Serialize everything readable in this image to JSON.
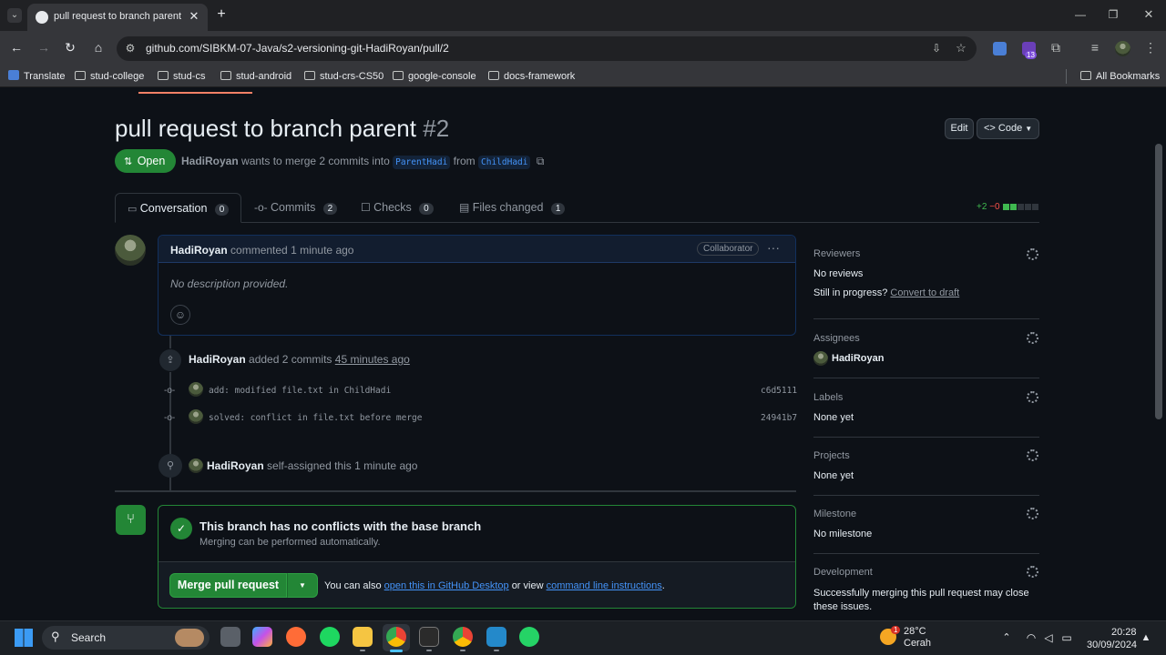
{
  "browser": {
    "tab_title": "pull request to branch parent b",
    "url": "github.com/SIBKM-07-Java/s2-versioning-git-HadiRoyan/pull/2",
    "bookmarks": [
      "Translate",
      "stud-college",
      "stud-cs",
      "stud-android",
      "stud-crs-CS50",
      "google-console",
      "docs-framework"
    ],
    "all_bookmarks": "All Bookmarks",
    "ext_badge": "13"
  },
  "pr": {
    "title": "pull request to branch parent",
    "number": "#2",
    "state": "Open",
    "author": "HadiRoyan",
    "merge_text": "wants to merge 2 commits into",
    "base_branch": "ParentHadi",
    "from_text": "from",
    "head_branch": "ChildHadi",
    "edit_label": "Edit",
    "code_label": "Code"
  },
  "tabs": [
    {
      "label": "Conversation",
      "count": "0"
    },
    {
      "label": "Commits",
      "count": "2"
    },
    {
      "label": "Checks",
      "count": "0"
    },
    {
      "label": "Files changed",
      "count": "1"
    }
  ],
  "diffstat": {
    "additions": "+2",
    "deletions": "−0"
  },
  "comment": {
    "author": "HadiRoyan",
    "action": "commented",
    "time": "1 minute ago",
    "badge": "Collaborator",
    "body": "No description provided."
  },
  "timeline": {
    "commits_author": "HadiRoyan",
    "commits_action": "added 2 commits",
    "commits_time": "45 minutes ago",
    "commits": [
      {
        "message": "add: modified file.txt in ChildHadi",
        "sha": "c6d5111"
      },
      {
        "message": "solved: conflict in file.txt before merge",
        "sha": "24941b7"
      }
    ],
    "assign_author": "HadiRoyan",
    "assign_text": "self-assigned this 1 minute ago"
  },
  "merge": {
    "title": "This branch has no conflicts with the base branch",
    "subtitle": "Merging can be performed automatically.",
    "button": "Merge pull request",
    "also_text": "You can also",
    "desktop_link": "open this in GitHub Desktop",
    "or_view": "or view",
    "cli_link": "command line instructions",
    "period": "."
  },
  "sidebar": {
    "reviewers_h": "Reviewers",
    "reviewers_v": "No reviews",
    "progress_text": "Still in progress?",
    "draft_link": "Convert to draft",
    "assignees_h": "Assignees",
    "assignees_v": "HadiRoyan",
    "labels_h": "Labels",
    "labels_v": "None yet",
    "projects_h": "Projects",
    "projects_v": "None yet",
    "milestone_h": "Milestone",
    "milestone_v": "No milestone",
    "development_h": "Development",
    "development_v": "Successfully merging this pull request may close these issues."
  },
  "taskbar": {
    "search": "Search",
    "temp": "28°C",
    "weather": "Cerah",
    "weather_badge": "1",
    "time": "20:28",
    "date": "30/09/2024"
  },
  "colors": {
    "green": "#238636",
    "link": "#4493f8",
    "bg": "#0d1117"
  }
}
